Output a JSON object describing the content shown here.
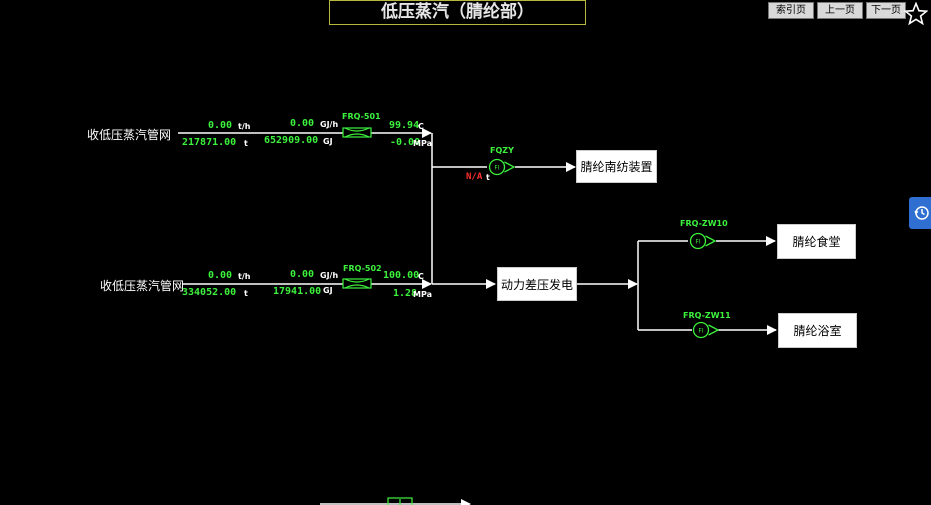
{
  "header": {
    "title": "低压蒸汽（腈纶部）"
  },
  "nav": {
    "index_label": "索引页",
    "prev_label": "上一页",
    "next_label": "下一页"
  },
  "line1": {
    "source_label": "收低压蒸汽管网",
    "flow_rate": "0.00",
    "flow_rate_unit": "t/h",
    "flow_total": "217871.00",
    "flow_total_unit": "t",
    "heat_rate": "0.00",
    "heat_rate_unit": "GJ/h",
    "heat_total": "652909.00",
    "heat_total_unit": "GJ",
    "meter_tag": "FRQ-501",
    "temperature": "99.94",
    "temperature_unit": "C",
    "pressure": "-0.00",
    "pressure_unit": "MPa"
  },
  "line2": {
    "source_label": "收低压蒸汽管网",
    "flow_rate": "0.00",
    "flow_rate_unit": "t/h",
    "flow_total": "334052.00",
    "flow_total_unit": "t",
    "heat_rate": "0.00",
    "heat_rate_unit": "GJ/h",
    "heat_total": "17941.00",
    "heat_total_unit": "GJ",
    "meter_tag": "FRQ-502",
    "temperature": "100.00",
    "temperature_unit": "C",
    "pressure": "1.28",
    "pressure_unit": "MPa"
  },
  "fqzy": {
    "tag": "FQZY",
    "value": "N/A",
    "unit": "t",
    "meter_symbol": "FI"
  },
  "zw10": {
    "tag": "FRQ-ZW10",
    "meter_symbol": "FI"
  },
  "zw11": {
    "tag": "FRQ-ZW11",
    "meter_symbol": "FI"
  },
  "boxes": {
    "south_spinning": "腈纶南纺装置",
    "power_station": "动力差压发电",
    "canteen": "腈纶食堂",
    "bathhouse": "腈纶浴室"
  },
  "colors": {
    "value_green": "#3cf23c",
    "alarm_red": "#ff3030",
    "nav_blue": "#2e6fd1"
  }
}
